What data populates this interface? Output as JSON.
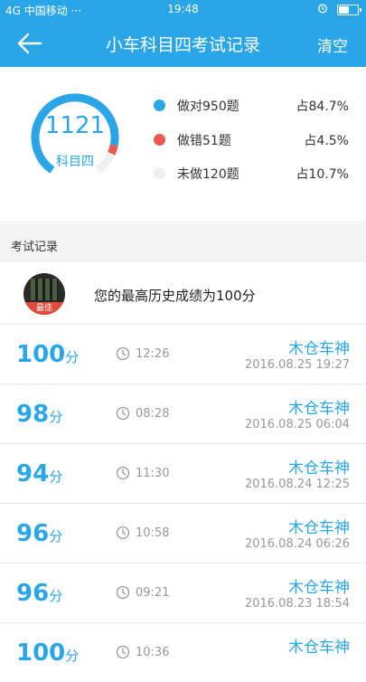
{
  "status_bar": {
    "signal": "4G",
    "carrier": "中国移动 ···",
    "time": "19:48",
    "battery_level": 0.5
  },
  "header": {
    "title": "小车科目四考试记录",
    "clear_label": "清空"
  },
  "summary": {
    "total": "1121",
    "subject": "科目四",
    "stats": [
      {
        "label": "做对950题",
        "percent": "占84.7%",
        "value": 84.7,
        "color": "#2aa6e8"
      },
      {
        "label": "做错51题",
        "percent": "占4.5%",
        "value": 4.5,
        "color": "#e85a50"
      },
      {
        "label": "未做120题",
        "percent": "占10.7%",
        "value": 10.7,
        "color": "#f0f0f0"
      }
    ]
  },
  "records_section": {
    "title": "考试记录",
    "best_badge": "最佳",
    "best_text": "您的最高历史成绩为100分"
  },
  "records": [
    {
      "score": "100",
      "unit": "分",
      "duration": "12:26",
      "name": "木仓车神",
      "date": "2016.08.25  19:27"
    },
    {
      "score": "98",
      "unit": "分",
      "duration": "08:28",
      "name": "木仓车神",
      "date": "2016.08.25  06:04"
    },
    {
      "score": "94",
      "unit": "分",
      "duration": "11:30",
      "name": "木仓车神",
      "date": "2016.08.24  12:25"
    },
    {
      "score": "96",
      "unit": "分",
      "duration": "10:58",
      "name": "木仓车神",
      "date": "2016.08.24  06:26"
    },
    {
      "score": "96",
      "unit": "分",
      "duration": "09:21",
      "name": "木仓车神",
      "date": "2016.08.23  18:54"
    },
    {
      "score": "100",
      "unit": "分",
      "duration": "10:36",
      "name": "木仓车神",
      "date": ""
    }
  ]
}
